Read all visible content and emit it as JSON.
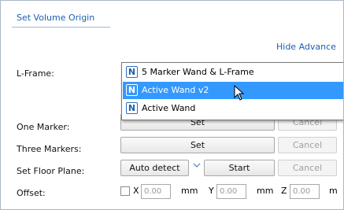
{
  "section": {
    "title": "Set Volume Origin"
  },
  "hide_advanced": {
    "label": "Hide Advance"
  },
  "lframe": {
    "label": "L-Frame:",
    "options": [
      {
        "label": "5 Marker Wand & L-Frame",
        "icon": "n-logo-icon",
        "selected": false
      },
      {
        "label": "Active Wand v2",
        "icon": "n-logo-icon",
        "selected": true
      },
      {
        "label": "Active Wand",
        "icon": "n-logo-icon",
        "selected": false
      }
    ]
  },
  "one_marker": {
    "label": "One Marker:",
    "set": "Set",
    "cancel": "Cancel"
  },
  "three_markers": {
    "label": "Three Markers:",
    "set": "Set",
    "cancel": "Cancel"
  },
  "floor_plane": {
    "label": "Set Floor Plane:",
    "auto_detect": "Auto detect",
    "start": "Start",
    "cancel": "Cancel"
  },
  "offset": {
    "label": "Offset:",
    "x_label": "X",
    "x_value": "0.00",
    "y_label": "Y",
    "y_value": "0.00",
    "z_label": "Z",
    "z_value": "0.00",
    "unit": "mm",
    "unit_cut": "m"
  },
  "colors": {
    "link": "#1c5fb0",
    "selection": "#3399ff"
  }
}
